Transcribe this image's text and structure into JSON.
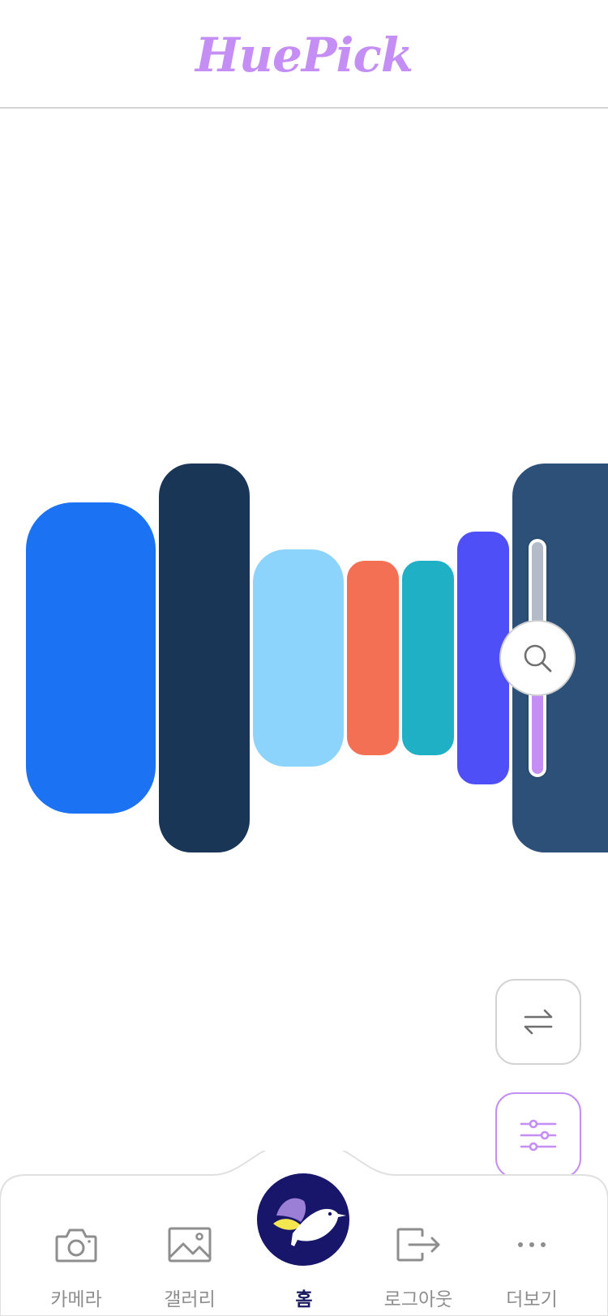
{
  "app": {
    "title": "HuePick",
    "title_color": "#c48ef5"
  },
  "palette": {
    "swatches": [
      {
        "color": "#1b73f4"
      },
      {
        "color": "#1a3657"
      },
      {
        "color": "#8dd4fc"
      },
      {
        "color": "#f47055"
      },
      {
        "color": "#1fb0c6"
      },
      {
        "color": "#4e4ff6"
      },
      {
        "color": "#2c5077"
      }
    ]
  },
  "slider": {
    "upper_color": "#b2bbc7",
    "lower_color": "#c48ef5",
    "level": 0.5,
    "icon": "search-icon"
  },
  "actions": {
    "swap": {
      "icon": "swap-arrows-icon"
    },
    "filter": {
      "icon": "sliders-icon",
      "accent": "#c48ef5"
    }
  },
  "tabbar": {
    "tabs": [
      {
        "label": "카메라",
        "icon": "camera-icon"
      },
      {
        "label": "갤러리",
        "icon": "gallery-icon"
      },
      {
        "label": "홈",
        "icon": "hummingbird-logo-icon",
        "active": true
      },
      {
        "label": "로그아웃",
        "icon": "logout-icon"
      },
      {
        "label": "더보기",
        "icon": "more-icon"
      }
    ],
    "home_circle_color": "#18166b",
    "inactive_color": "#8e8e8e"
  }
}
